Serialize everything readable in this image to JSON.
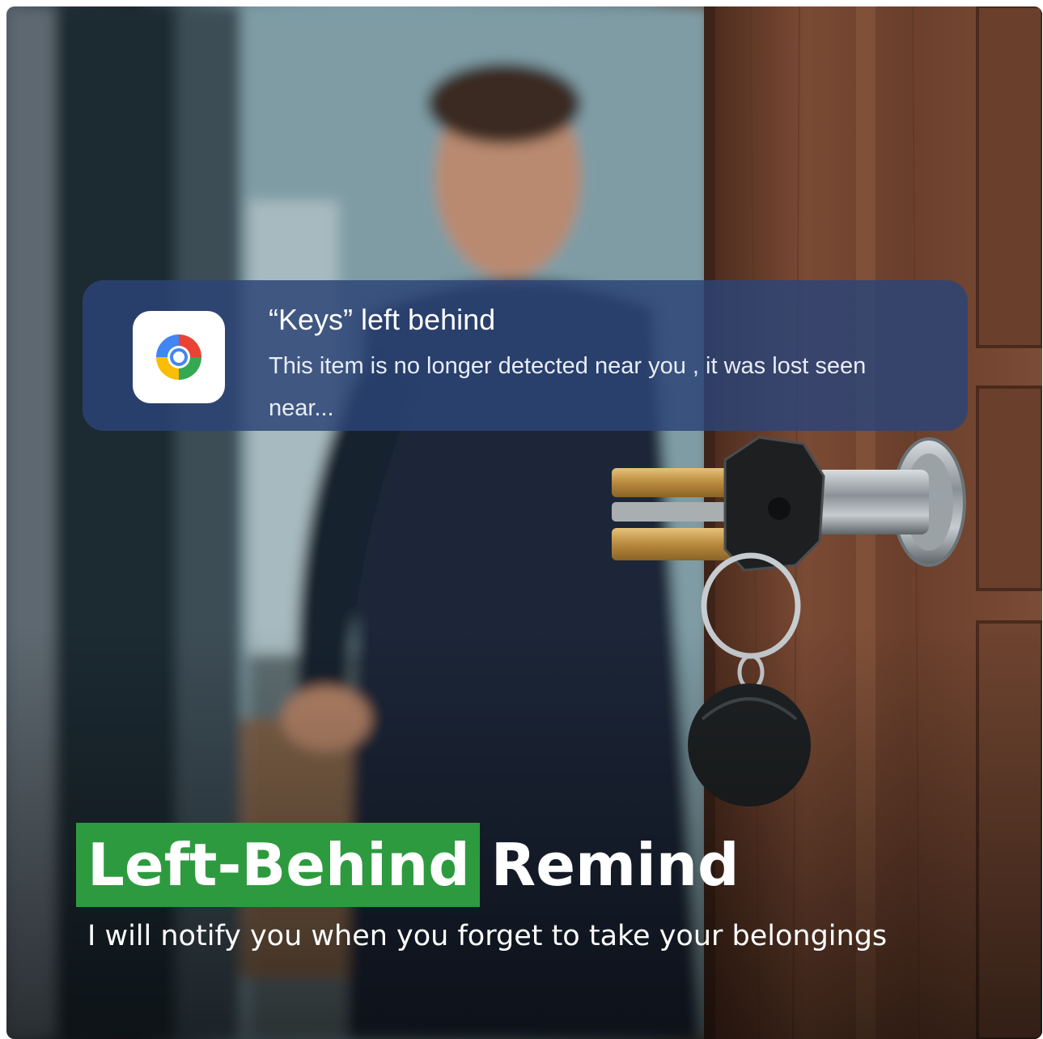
{
  "notification": {
    "title": "“Keys” left behind",
    "body": "This item is no longer detected near you , it was lost seen near...",
    "app_icon": "find-my-device-icon",
    "icon_colors": [
      "#4285f4",
      "#ea4335",
      "#fbbc05",
      "#34a853"
    ],
    "background": "#2c4476"
  },
  "headline": {
    "highlight": "Left-Behind",
    "rest": "Remind",
    "highlight_color": "#2e9a3f"
  },
  "subline": "I will notify you when you forget to take your belongings"
}
